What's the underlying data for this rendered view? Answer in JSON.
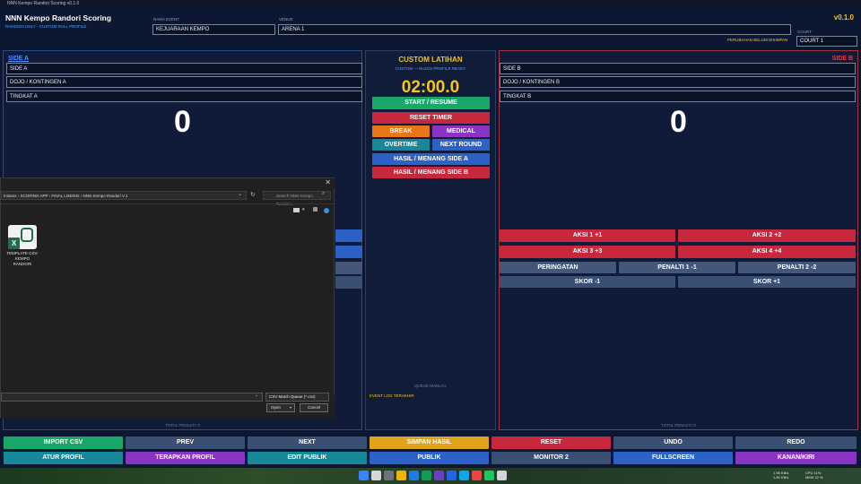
{
  "window": {
    "title": "NNN Kempo Randori Scoring v0.1.0"
  },
  "header": {
    "app_title": "NNN Kempo Randori Scoring",
    "subtitle": "RANDORI ONLY - CUSTOM RULL PROFILE",
    "event_label": "NAMA EVENT",
    "event_value": "KEJUARAAN KEMPO",
    "venue_label": "VENUE",
    "venue_value": "ARENA 1",
    "version": "v0.1.0",
    "court_label": "COURT",
    "court_value": "COURT 1",
    "unsaved_notice": "PERUBAHAN BELUM DISIMPAN"
  },
  "side_a": {
    "header": "SIDE A",
    "name": "SIDE A",
    "dojo": "DOJO / KONTINGEN A",
    "level": "TINGKAT A",
    "score": "0",
    "total_penalty": "TOTAL PENALTI: 0"
  },
  "side_b": {
    "header": "SIDE B",
    "name": "SIDE B",
    "dojo": "DOJO / KONTINGEN B",
    "level": "TINGKAT B",
    "score": "0",
    "total_penalty": "TOTAL PENALTI: 0",
    "actions": {
      "aksi1": "AKSI 1  +1",
      "aksi2": "AKSI 2  +2",
      "aksi3": "AKSI 3  +3",
      "aksi4": "AKSI 4  +4",
      "peringatan": "PERINGATAN",
      "penalti1": "PENALTI 1  -1",
      "penalti2": "PENALTI 2  -2",
      "skor_minus": "SKOR -1",
      "skor_plus": "SKOR +1"
    }
  },
  "center": {
    "title": "CUSTOM LATIHAN",
    "profile_note": "CUSTOM — RULES PROFILE READY",
    "timer": "02:00.0",
    "start": "START / RESUME",
    "reset_timer": "RESET TIMER",
    "break": "BREAK",
    "medical": "MEDICAL",
    "overtime": "OVERTIME",
    "next_round": "NEXT ROUND",
    "win_a": "HASIL / MENANG SIDE A",
    "win_b": "HASIL / MENANG SIDE B",
    "queue_label": "QUEUE MANUAL",
    "event_log_label": "EVENT LOG TERAKHIR"
  },
  "bottom_bar": {
    "row1": [
      "IMPORT CSV",
      "PREV",
      "NEXT",
      "SIMPAN HASIL",
      "RESET",
      "UNDO",
      "REDO"
    ],
    "row2": [
      "ATUR PROFIL",
      "TERAPKAN PROFIL",
      "EDIT PUBLIK",
      "PUBLIK",
      "MONITOR 2",
      "FULLSCREEN",
      "KANAN/KIRI"
    ]
  },
  "file_dialog": {
    "breadcrumb": "Instans  ›  SCORING APP  ›  FINAL LISENSI  ›  NNN Kempo Randori V.1",
    "search_placeholder": "Search NNN Kempo Randori...",
    "file_name": "TEMPLATE-CSV-KEMPO RANDORI",
    "file_type": "CSV Match Queue (*.csv)",
    "open_label": "Open",
    "cancel_label": "Cancel"
  },
  "taskbar": {
    "net_up": "1.98 KB/s",
    "net_down": "1.80 KB/s",
    "cpu": "CPU 11%",
    "mem": "MEM 22 %"
  },
  "colors": {
    "accent_gold": "#f5c518",
    "side_a_blue": "#2b4a8a",
    "side_b_red": "#c8283e",
    "bg": "#0c1731"
  }
}
